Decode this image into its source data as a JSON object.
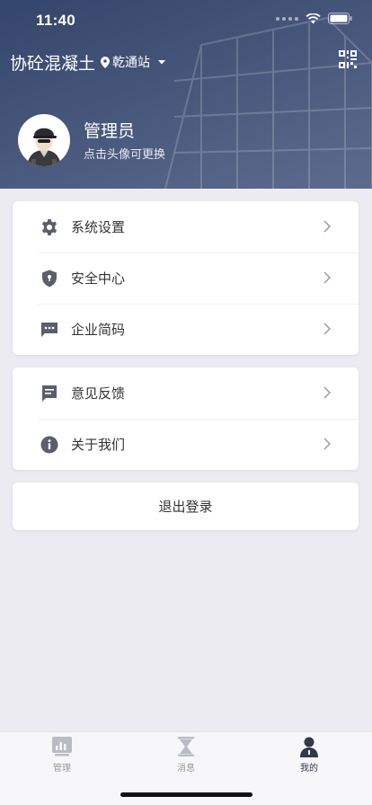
{
  "status_bar": {
    "time": "11:40"
  },
  "header": {
    "app_title": "协砼混凝土",
    "station": "乾通站",
    "icons": {
      "location": "location-pin-icon",
      "dropdown": "caret-down-icon",
      "scan": "qr-scan-icon"
    }
  },
  "profile": {
    "name": "管理员",
    "hint": "点击头像可更换"
  },
  "menu_group_1": [
    {
      "label": "系统设置",
      "icon": "gear-icon"
    },
    {
      "label": "安全中心",
      "icon": "shield-icon"
    },
    {
      "label": "企业简码",
      "icon": "message-icon"
    }
  ],
  "menu_group_2": [
    {
      "label": "意见反馈",
      "icon": "feedback-icon"
    },
    {
      "label": "关于我们",
      "icon": "info-icon"
    }
  ],
  "logout_label": "退出登录",
  "tabbar": [
    {
      "label": "管理",
      "icon": "chart-icon",
      "active": false
    },
    {
      "label": "消息",
      "icon": "hourglass-icon",
      "active": false
    },
    {
      "label": "我的",
      "icon": "user-icon",
      "active": true
    }
  ],
  "colors": {
    "header": "#3d4e73",
    "icon": "#5b5e6b",
    "background": "#ecebf1",
    "active_tab": "#33384a"
  }
}
